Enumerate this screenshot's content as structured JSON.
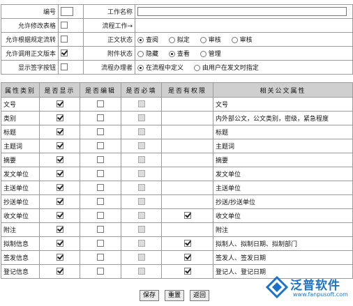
{
  "settings": {
    "row1": {
      "label_a": "编号",
      "label_b": "工作名称"
    },
    "row2": {
      "label_a": "允许修改表格",
      "label_b": "流程工作→"
    },
    "row3": {
      "label_a": "允许根据规定流转",
      "label_b": "正文状态",
      "options": [
        "查阅",
        "拟定",
        "审核",
        "审核"
      ],
      "selected": 0
    },
    "row4": {
      "label_a": "允许调用正文版本",
      "label_b": "附件状态",
      "options": [
        "隐藏",
        "查看",
        "管理"
      ],
      "selected": 1
    },
    "row5": {
      "label_a": "显示签字按钮",
      "label_b": "流程办理者",
      "options": [
        "在流程中定义",
        "由用户在发文时指定"
      ],
      "selected": 0
    }
  },
  "fields": {
    "headers": [
      "属性类别",
      "是否显示",
      "是否编辑",
      "是否必填",
      "是否有权限",
      "相关公文属性"
    ],
    "rows": [
      {
        "name": "文号",
        "show": true,
        "edit": false,
        "required": false,
        "perm": false,
        "related": "文号"
      },
      {
        "name": "类别",
        "show": true,
        "edit": false,
        "required": false,
        "perm": false,
        "related": "内外部公文，公文类别，密级，紧急程度"
      },
      {
        "name": "标题",
        "show": true,
        "edit": false,
        "required": false,
        "perm": false,
        "related": "标题"
      },
      {
        "name": "主题词",
        "show": true,
        "edit": false,
        "required": false,
        "perm": false,
        "related": "主题词"
      },
      {
        "name": "摘要",
        "show": true,
        "edit": false,
        "required": false,
        "perm": false,
        "related": "摘要"
      },
      {
        "name": "发文单位",
        "show": true,
        "edit": false,
        "required": false,
        "perm": false,
        "related": "发文单位"
      },
      {
        "name": "主送单位",
        "show": true,
        "edit": false,
        "required": false,
        "perm": false,
        "related": "主送单位"
      },
      {
        "name": "抄送单位",
        "show": true,
        "edit": false,
        "required": false,
        "perm": false,
        "related": "抄送/抄送单位"
      },
      {
        "name": "收文单位",
        "show": true,
        "edit": false,
        "required": false,
        "perm": true,
        "related": "收文单位"
      },
      {
        "name": "附注",
        "show": true,
        "edit": false,
        "required": false,
        "perm": false,
        "related": "附注"
      },
      {
        "name": "拟制信息",
        "show": true,
        "edit": false,
        "required": false,
        "perm": true,
        "related": "拟制人、拟制日期、拟制部门"
      },
      {
        "name": "签发信息",
        "show": true,
        "edit": false,
        "required": false,
        "perm": true,
        "related": "签发人、签发日期"
      },
      {
        "name": "登记信息",
        "show": true,
        "edit": false,
        "required": false,
        "perm": true,
        "related": "登记人、登记日期"
      }
    ]
  },
  "buttons": {
    "save": "保存",
    "reset": "重置",
    "back": "返回"
  },
  "logo": {
    "name": "泛普软件",
    "url": "www.fanpusoft.com"
  }
}
